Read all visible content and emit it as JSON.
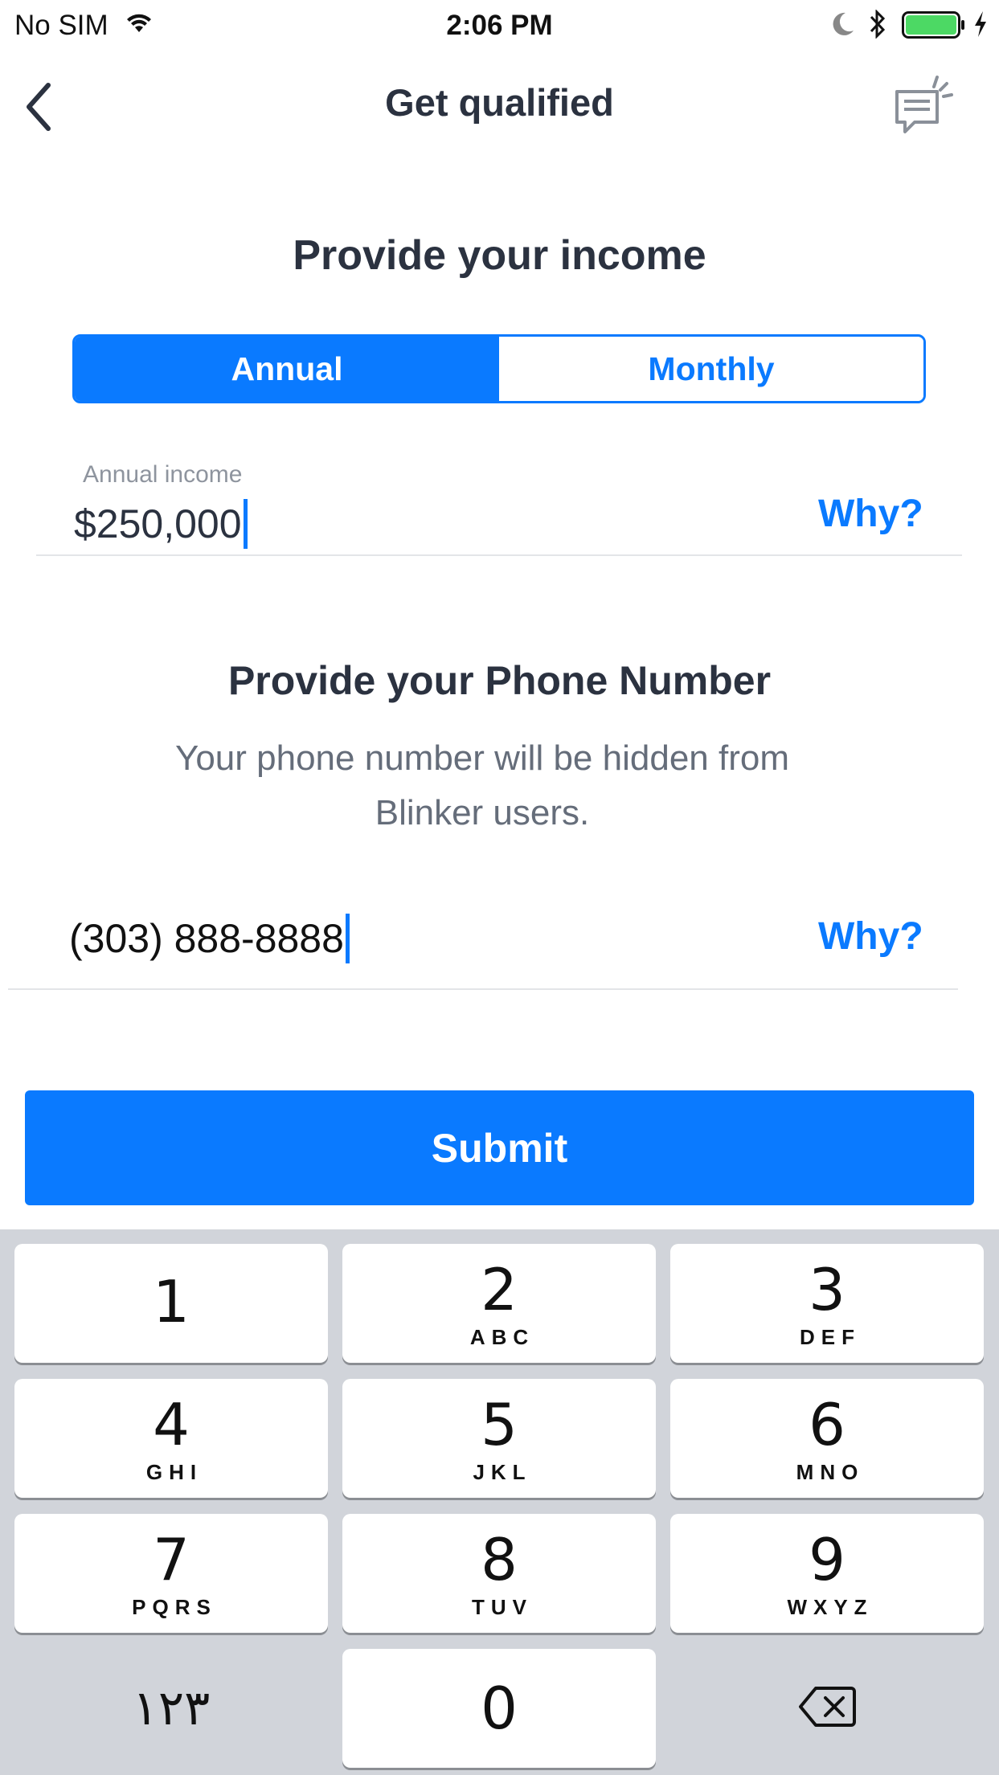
{
  "status_bar": {
    "carrier": "No SIM",
    "time": "2:06 PM",
    "icons": [
      "wifi-icon",
      "moon-icon",
      "bluetooth-icon",
      "battery-icon",
      "charging-icon"
    ],
    "battery_color": "#4cd964"
  },
  "nav": {
    "title": "Get qualified",
    "back_icon": "chevron-left-icon",
    "chat_icon": "chat-icon"
  },
  "income": {
    "heading": "Provide your income",
    "tabs": [
      {
        "label": "Annual",
        "selected": true
      },
      {
        "label": "Monthly",
        "selected": false
      }
    ],
    "field_label": "Annual income",
    "value": "$250,000",
    "why_label": "Why?"
  },
  "phone": {
    "heading": "Provide your Phone Number",
    "subtext": "Your phone number will be hidden from Blinker users.",
    "value": "(303) 888-8888",
    "why_label": "Why?"
  },
  "submit_label": "Submit",
  "keypad": {
    "keys": [
      {
        "num": "1",
        "letters": ""
      },
      {
        "num": "2",
        "letters": "ABC"
      },
      {
        "num": "3",
        "letters": "DEF"
      },
      {
        "num": "4",
        "letters": "GHI"
      },
      {
        "num": "5",
        "letters": "JKL"
      },
      {
        "num": "6",
        "letters": "MNO"
      },
      {
        "num": "7",
        "letters": "PQRS"
      },
      {
        "num": "8",
        "letters": "TUV"
      },
      {
        "num": "9",
        "letters": "WXYZ"
      },
      {
        "num": "0",
        "letters": ""
      }
    ],
    "alt_key": "١٢٣",
    "delete_icon": "backspace-icon"
  },
  "colors": {
    "accent": "#0a7aff",
    "text_dark": "#2b3240",
    "text_muted": "#656d7a",
    "keypad_bg": "#d1d4da"
  }
}
